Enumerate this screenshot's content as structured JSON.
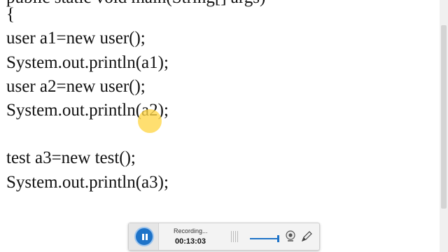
{
  "code": {
    "partial_top": "public static void main(String[] args)",
    "lines": [
      "{",
      "user a1=new user();",
      "System.out.println(a1);",
      "user a2=new user();",
      "System.out.println(a2);",
      "",
      "test a3=new test();",
      "System.out.println(a3);"
    ]
  },
  "recorder": {
    "status": "Recording...",
    "time": "00:13:03",
    "pause_icon": "pause-icon",
    "webcam_icon": "webcam-icon",
    "pencil_icon": "pencil-icon",
    "accent_color": "#1e73c8"
  }
}
